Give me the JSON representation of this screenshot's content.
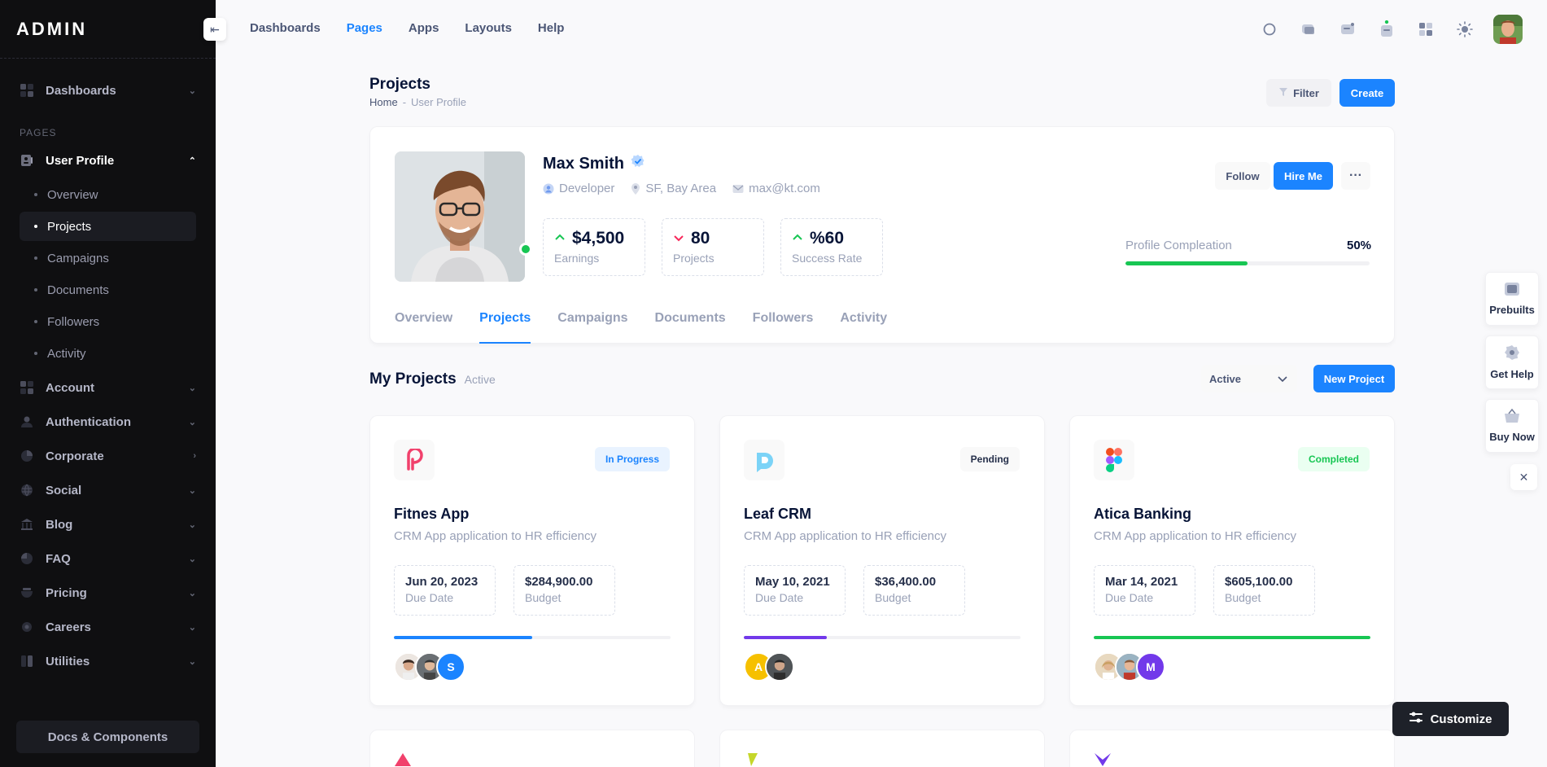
{
  "sidebar": {
    "logo": "ADMIN",
    "section_pages": "PAGES",
    "items_top": [
      {
        "label": "Dashboards"
      }
    ],
    "user_profile": {
      "label": "User Profile",
      "subitems": [
        {
          "label": "Overview"
        },
        {
          "label": "Projects"
        },
        {
          "label": "Campaigns"
        },
        {
          "label": "Documents"
        },
        {
          "label": "Followers"
        },
        {
          "label": "Activity"
        }
      ]
    },
    "items": [
      {
        "label": "Account"
      },
      {
        "label": "Authentication"
      },
      {
        "label": "Corporate"
      },
      {
        "label": "Social"
      },
      {
        "label": "Blog"
      },
      {
        "label": "FAQ"
      },
      {
        "label": "Pricing"
      },
      {
        "label": "Careers"
      },
      {
        "label": "Utilities"
      }
    ],
    "docs_button": "Docs & Components"
  },
  "topnav": [
    {
      "label": "Dashboards"
    },
    {
      "label": "Pages"
    },
    {
      "label": "Apps"
    },
    {
      "label": "Layouts"
    },
    {
      "label": "Help"
    }
  ],
  "page": {
    "title": "Projects",
    "breadcrumb": [
      "Home",
      "-",
      "User Profile"
    ],
    "filter_label": "Filter",
    "create_label": "Create"
  },
  "profile": {
    "name": "Max Smith",
    "role": "Developer",
    "location": "SF, Bay Area",
    "email": "max@kt.com",
    "stats": [
      {
        "value": "$4,500",
        "label": "Earnings",
        "trend": "up"
      },
      {
        "value": "80",
        "label": "Projects",
        "trend": "down"
      },
      {
        "value": "%60",
        "label": "Success Rate",
        "trend": "up"
      }
    ],
    "follow_label": "Follow",
    "hire_label": "Hire Me",
    "more_label": "···",
    "completion_label": "Profile Compleation",
    "completion_value": "50%",
    "completion_fraction": 0.5,
    "tabs": [
      {
        "label": "Overview"
      },
      {
        "label": "Projects"
      },
      {
        "label": "Campaigns"
      },
      {
        "label": "Documents"
      },
      {
        "label": "Followers"
      },
      {
        "label": "Activity"
      }
    ]
  },
  "my_projects": {
    "title": "My Projects",
    "subtitle": "Active",
    "select_value": "Active",
    "new_project_label": "New Project",
    "cards": [
      {
        "title": "Fitnes App",
        "desc": "CRM App application to HR efficiency",
        "status": "In Progress",
        "status_color": "#1b84ff",
        "status_bg": "#e9f3ff",
        "due": "Jun 20, 2023",
        "due_label": "Due Date",
        "budget": "$284,900.00",
        "budget_label": "Budget",
        "progress": 0.5,
        "progress_color": "#1b84ff",
        "users": [
          "",
          "",
          "S"
        ]
      },
      {
        "title": "Leaf CRM",
        "desc": "CRM App application to HR efficiency",
        "status": "Pending",
        "status_color": "#252f4a",
        "status_bg": "#f9f9f9",
        "due": "May 10, 2021",
        "due_label": "Due Date",
        "budget": "$36,400.00",
        "budget_label": "Budget",
        "progress": 0.3,
        "progress_color": "#7239ea",
        "users": [
          "A",
          ""
        ]
      },
      {
        "title": "Atica Banking",
        "desc": "CRM App application to HR efficiency",
        "status": "Completed",
        "status_color": "#17c653",
        "status_bg": "#eafff1",
        "due": "Mar 14, 2021",
        "due_label": "Due Date",
        "budget": "$605,100.00",
        "budget_label": "Budget",
        "progress": 1.0,
        "progress_color": "#17c653",
        "users": [
          "",
          "",
          "M"
        ]
      }
    ]
  },
  "floating": {
    "prebuilts": "Prebuilts",
    "get_help": "Get Help",
    "buy_now": "Buy Now",
    "customize": "Customize"
  }
}
